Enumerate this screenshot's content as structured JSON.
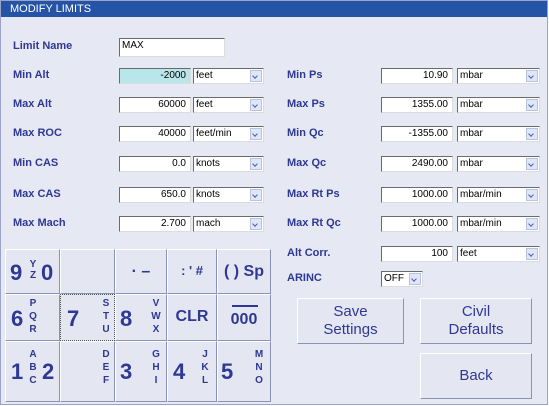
{
  "title": "MODIFY LIMITS",
  "limit_name": {
    "label": "Limit Name",
    "value": "MAX"
  },
  "left": [
    {
      "label": "Min Alt",
      "value": "-2000",
      "unit": "feet"
    },
    {
      "label": "Max Alt",
      "value": "60000",
      "unit": "feet"
    },
    {
      "label": "Max ROC",
      "value": "40000",
      "unit": "feet/min"
    },
    {
      "label": "Min CAS",
      "value": "0.0",
      "unit": "knots"
    },
    {
      "label": "Max CAS",
      "value": "650.0",
      "unit": "knots"
    },
    {
      "label": "Max Mach",
      "value": "2.700",
      "unit": "mach"
    }
  ],
  "right": [
    {
      "label": "Min Ps",
      "value": "10.90",
      "unit": "mbar"
    },
    {
      "label": "Max Ps",
      "value": "1355.00",
      "unit": "mbar"
    },
    {
      "label": "Min Qc",
      "value": "-1355.00",
      "unit": "mbar"
    },
    {
      "label": "Max Qc",
      "value": "2490.00",
      "unit": "mbar"
    },
    {
      "label": "Max Rt Ps",
      "value": "1000.00",
      "unit": "mbar/min"
    },
    {
      "label": "Max Rt Qc",
      "value": "1000.00",
      "unit": "mbar/min"
    },
    {
      "label": "Alt Corr.",
      "value": "100",
      "unit": "feet"
    }
  ],
  "arinc": {
    "label": "ARINC",
    "value": "OFF"
  },
  "keypad": {
    "k9": {
      "digit": "9",
      "letters": [
        "Y",
        "Z"
      ]
    },
    "k0": {
      "digit": "0"
    },
    "dot_minus": "· –",
    "colon_hash": ": ' #",
    "paren_sp": "( ) Sp",
    "k6": {
      "digit": "6",
      "letters": [
        "P",
        "Q",
        "R"
      ]
    },
    "k7": {
      "digit": "7",
      "letters": [
        "S",
        "T",
        "U"
      ]
    },
    "k8": {
      "digit": "8",
      "letters": [
        "V",
        "W",
        "X"
      ]
    },
    "clr": "CLR",
    "k000": "000",
    "k1": {
      "digit": "1",
      "letters": [
        "A",
        "B",
        "C"
      ]
    },
    "k2": {
      "digit": "2",
      "letters": [
        "D",
        "E",
        "F"
      ]
    },
    "k3": {
      "digit": "3",
      "letters": [
        "G",
        "H",
        "I"
      ]
    },
    "k4": {
      "digit": "4",
      "letters": [
        "J",
        "K",
        "L"
      ]
    },
    "k5": {
      "digit": "5",
      "letters": [
        "M",
        "N",
        "O"
      ]
    }
  },
  "buttons": {
    "save_line1": "Save",
    "save_line2": "Settings",
    "civil_line1": "Civil",
    "civil_line2": "Defaults",
    "back": "Back"
  }
}
